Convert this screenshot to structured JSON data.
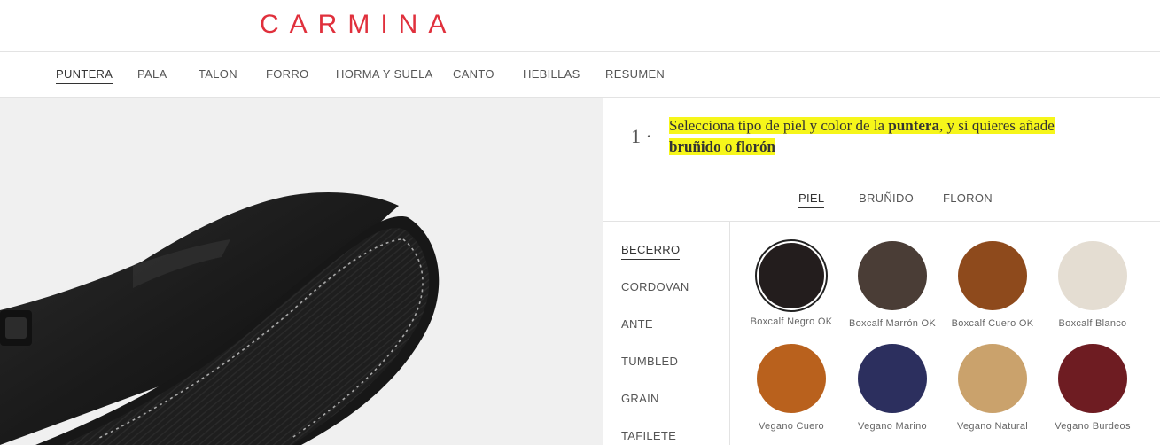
{
  "brand": {
    "logo": "CARMINA"
  },
  "nav": {
    "items": [
      {
        "label": "PUNTERA",
        "active": true
      },
      {
        "label": "PALA",
        "active": false
      },
      {
        "label": "TALON",
        "active": false
      },
      {
        "label": "FORRO",
        "active": false
      },
      {
        "label": "HORMA Y SUELA",
        "active": false
      },
      {
        "label": "CANTO",
        "active": false
      },
      {
        "label": "HEBILLAS",
        "active": false
      },
      {
        "label": "RESUMEN",
        "active": false
      }
    ]
  },
  "step": {
    "number": "1 ·",
    "text_1": "Selecciona tipo de piel y color de la ",
    "bold_1": "puntera",
    "text_2": ", y si quieres añade ",
    "bold_2": "bruñido",
    "text_3": " o ",
    "bold_3": "florón"
  },
  "subtabs": [
    {
      "label": "PIEL",
      "active": true
    },
    {
      "label": "BRUÑIDO",
      "active": false
    },
    {
      "label": "FLORON",
      "active": false
    }
  ],
  "materials": [
    {
      "label": "BECERRO",
      "active": true
    },
    {
      "label": "CORDOVAN",
      "active": false
    },
    {
      "label": "ANTE",
      "active": false
    },
    {
      "label": "TUMBLED",
      "active": false
    },
    {
      "label": "GRAIN",
      "active": false
    },
    {
      "label": "TAFILETE",
      "active": false
    }
  ],
  "swatches": [
    {
      "label": "Boxcalf Negro OK",
      "color": "#231d1d",
      "selected": true
    },
    {
      "label": "Boxcalf Marrón OK",
      "color": "#4a3d36",
      "selected": false
    },
    {
      "label": "Boxcalf Cuero OK",
      "color": "#8e4a1c",
      "selected": false
    },
    {
      "label": "Boxcalf Blanco",
      "color": "#e4ddd2",
      "selected": false
    },
    {
      "label": "Vegano Cuero",
      "color": "#b9611d",
      "selected": false
    },
    {
      "label": "Vegano Marino",
      "color": "#2c2f5e",
      "selected": false
    },
    {
      "label": "Vegano Natural",
      "color": "#caa26c",
      "selected": false
    },
    {
      "label": "Vegano Burdeos",
      "color": "#6e1c22",
      "selected": false
    }
  ],
  "colors": {
    "logo": "#e0303c",
    "highlight": "#f6f61a"
  }
}
